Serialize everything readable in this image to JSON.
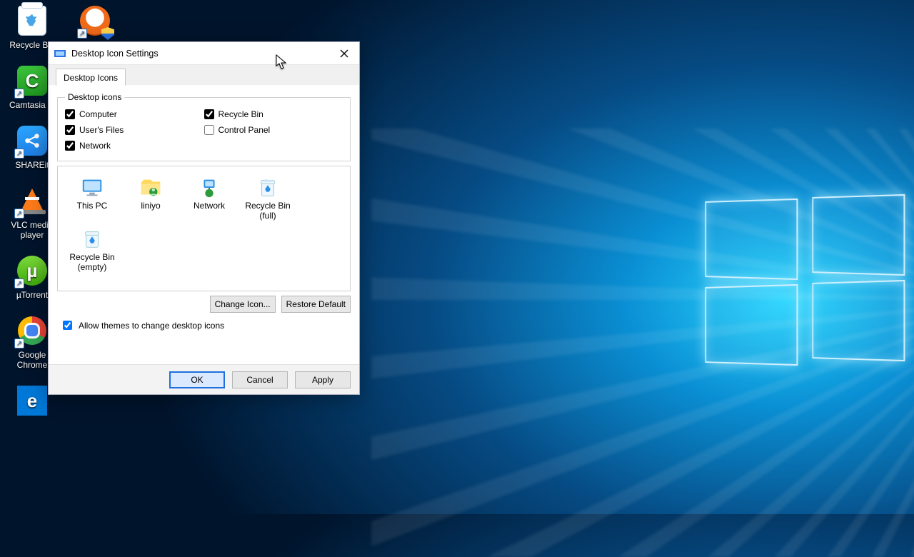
{
  "desktop": {
    "icons": [
      {
        "id": "recycle-bin",
        "label": "Recycle Bin"
      },
      {
        "id": "daemon",
        "label": ""
      },
      {
        "id": "camtasia",
        "label": "Camtasia ..."
      },
      {
        "id": "shareit",
        "label": "SHAREit"
      },
      {
        "id": "vlc",
        "label": "VLC media player"
      },
      {
        "id": "utorrent",
        "label": "µTorrent"
      },
      {
        "id": "chrome",
        "label": "Google Chrome"
      },
      {
        "id": "edge",
        "label": ""
      }
    ]
  },
  "dialog": {
    "title": "Desktop Icon Settings",
    "tab_label": "Desktop Icons",
    "group_label": "Desktop icons",
    "checks": {
      "computer": {
        "label": "Computer",
        "checked": true
      },
      "users_files": {
        "label": "User's Files",
        "checked": true
      },
      "network": {
        "label": "Network",
        "checked": true
      },
      "recycle_bin": {
        "label": "Recycle Bin",
        "checked": true
      },
      "control_panel": {
        "label": "Control Panel",
        "checked": false
      }
    },
    "preview": [
      {
        "id": "this-pc",
        "label": "This PC"
      },
      {
        "id": "user-folder",
        "label": "liniyo"
      },
      {
        "id": "network",
        "label": "Network"
      },
      {
        "id": "bin-full",
        "label": "Recycle Bin (full)"
      },
      {
        "id": "bin-empty",
        "label": "Recycle Bin (empty)"
      }
    ],
    "buttons": {
      "change_icon": "Change Icon...",
      "restore_default": "Restore Default",
      "ok": "OK",
      "cancel": "Cancel",
      "apply": "Apply"
    },
    "allow_themes": {
      "label": "Allow themes to change desktop icons",
      "checked": true
    }
  }
}
